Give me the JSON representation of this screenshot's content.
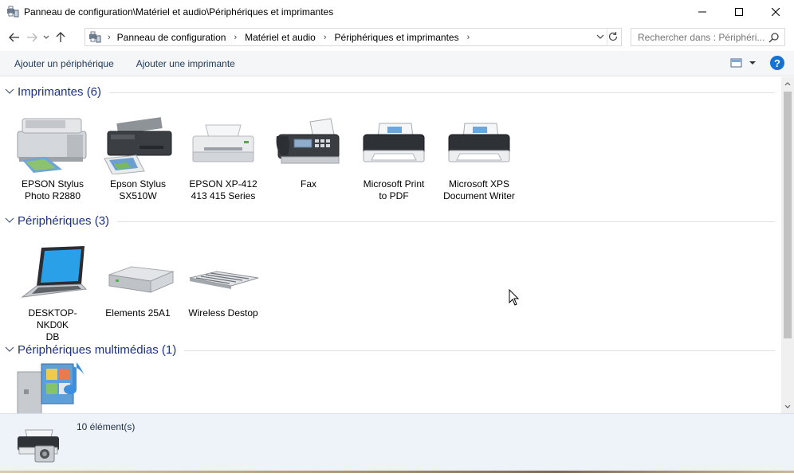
{
  "window": {
    "title": "Panneau de configuration\\Matériel et audio\\Périphériques et imprimantes",
    "minimize": "minimize-icon",
    "maximize": "maximize-icon",
    "close": "close-icon"
  },
  "address": {
    "breadcrumbs": [
      "Panneau de configuration",
      "Matériel et audio",
      "Périphériques et imprimantes"
    ],
    "search_placeholder": "Rechercher dans : Périphéri..."
  },
  "toolbar": {
    "add_device": "Ajouter un périphérique",
    "add_printer": "Ajouter une imprimante",
    "help": "?"
  },
  "groups": {
    "printers": {
      "title": "Imprimantes (6)",
      "items": [
        {
          "line1": "EPSON Stylus",
          "line2": "Photo R2880",
          "icon": "photo-printer-icon"
        },
        {
          "line1": "Epson Stylus",
          "line2": "SX510W",
          "icon": "inkjet-printer-icon"
        },
        {
          "line1": "EPSON XP-412",
          "line2": "413 415 Series",
          "icon": "printer-icon"
        },
        {
          "line1": "Fax",
          "line2": "",
          "icon": "fax-icon"
        },
        {
          "line1": "Microsoft Print",
          "line2": "to PDF",
          "icon": "virtual-printer-icon"
        },
        {
          "line1": "Microsoft XPS",
          "line2": "Document Writer",
          "icon": "virtual-printer-icon"
        }
      ]
    },
    "devices": {
      "title": "Périphériques (3)",
      "items": [
        {
          "line1": "DESKTOP-NKD0K",
          "line2": "DB",
          "icon": "laptop-icon"
        },
        {
          "line1": "Elements 25A1",
          "line2": "",
          "icon": "external-drive-icon"
        },
        {
          "line1": "Wireless Destop",
          "line2": "",
          "icon": "keyboard-icon"
        }
      ]
    },
    "multimedia": {
      "title": "Périphériques multimédias (1)",
      "items": [
        {
          "line1": "",
          "line2": "",
          "icon": "media-device-icon"
        }
      ]
    }
  },
  "details": {
    "count": "10 élément(s)"
  },
  "colors": {
    "group_title": "#1e3287",
    "command_text": "#1e395b",
    "details_bg": "#eef3fa",
    "help_blue": "#1572d3"
  }
}
